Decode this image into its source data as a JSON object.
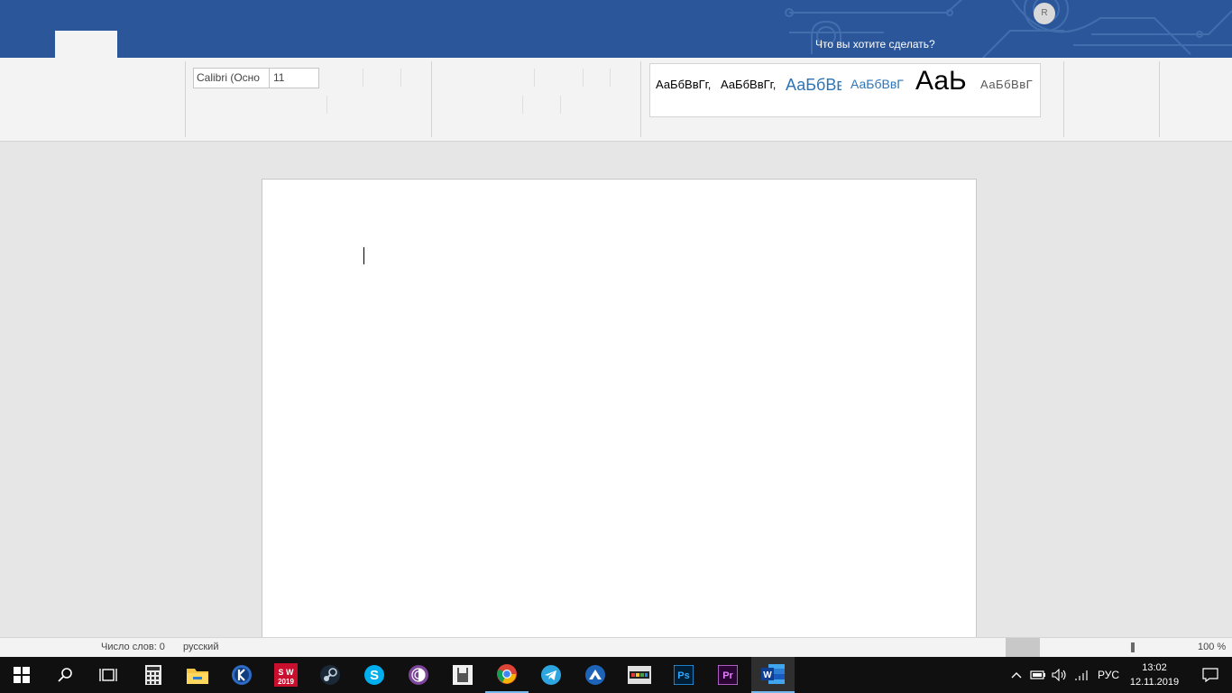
{
  "title_bar": {
    "tell_me": "Что вы хотите сделать?",
    "user_initial": "R"
  },
  "ribbon": {
    "font_name": "Calibri (Осно",
    "font_size": "11",
    "styles": [
      "АаБбВвГг,",
      "АаБбВвГг,",
      "АаБбВв",
      "АаБбВвГ",
      "АаЬ",
      "АаБбВвГ"
    ]
  },
  "status_bar": {
    "word_count": "Число слов: 0",
    "language": "русский",
    "zoom": "100 %"
  },
  "taskbar": {
    "apps": [
      "start-icon",
      "search-icon",
      "task-view-icon",
      "calculator-icon",
      "file-explorer-icon",
      "kompas-icon",
      "solidworks-icon",
      "steam-icon",
      "skype-icon",
      "tor-icon",
      "notes-icon",
      "chrome-icon",
      "telegram-icon",
      "app-icon",
      "dvd-icon",
      "photoshop-icon",
      "premiere-icon",
      "word-icon"
    ],
    "solidworks_label": "S W",
    "solidworks_year": "2019",
    "photoshop_label": "Ps",
    "premiere_label": "Pr",
    "word_label": "W",
    "skype_label": "S",
    "language_indicator": "РУС",
    "time": "13:02",
    "date": "12.11.2019"
  },
  "colors": {
    "title_bar": "#2b579a",
    "ribbon": "#f3f3f3",
    "canvas": "#e6e6e6",
    "taskbar": "#101010",
    "accent_blue": "#2e74b5"
  }
}
